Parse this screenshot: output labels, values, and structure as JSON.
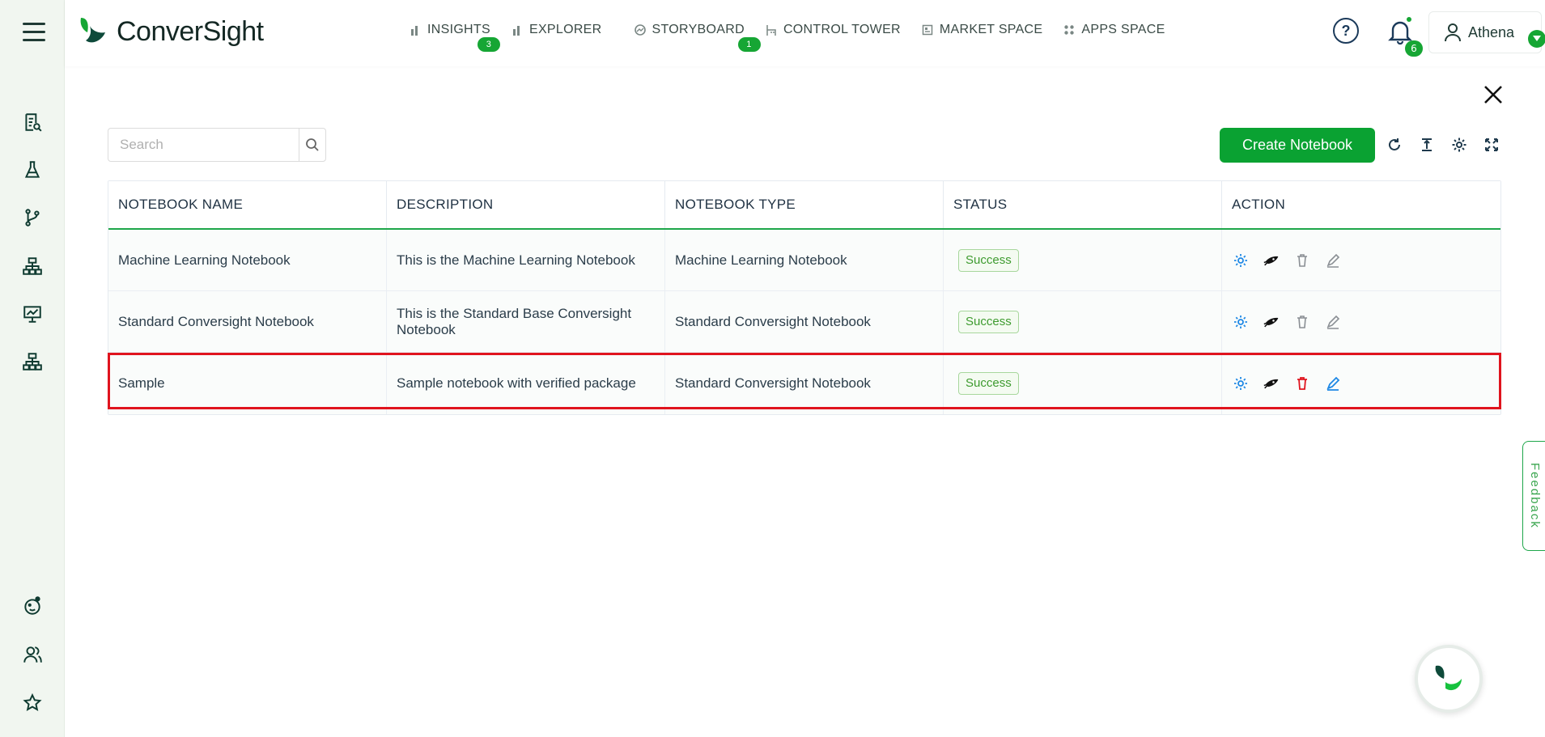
{
  "app": {
    "logo_text": "ConverSight"
  },
  "nav": {
    "items": [
      {
        "label": "INSIGHTS",
        "badge": "3"
      },
      {
        "label": "EXPLORER",
        "badge": ""
      },
      {
        "label": "STORYBOARD",
        "badge": "1"
      },
      {
        "label": "CONTROL TOWER",
        "badge": ""
      },
      {
        "label": "MARKET SPACE",
        "badge": ""
      },
      {
        "label": "APPS SPACE",
        "badge": ""
      }
    ]
  },
  "header": {
    "help_label": "?",
    "notification_count": "6",
    "user_name": "Athena"
  },
  "toolbar": {
    "search_placeholder": "Search",
    "search_value": "",
    "create_label": "Create Notebook"
  },
  "table": {
    "columns": [
      "NOTEBOOK NAME",
      "DESCRIPTION",
      "NOTEBOOK TYPE",
      "STATUS",
      "ACTION"
    ],
    "rows": [
      {
        "name": "Machine Learning Notebook",
        "description": "This is the Machine Learning Notebook",
        "type": "Machine Learning Notebook",
        "status": "Success"
      },
      {
        "name": "Standard Conversight Notebook",
        "description": "This is the Standard Base Conversight Notebook",
        "type": "Standard Conversight Notebook",
        "status": "Success"
      },
      {
        "name": "Sample",
        "description": "Sample notebook with verified package",
        "type": "Standard Conversight Notebook",
        "status": "Success"
      }
    ]
  },
  "feedback_label": "Feedback",
  "colors": {
    "brand_green": "#0aa232",
    "highlight_red": "#e0141e",
    "rail_bg": "#f1f6f0",
    "action_blue": "#1e88e5"
  },
  "icons": {
    "rail_top": [
      "report-icon",
      "flask-icon",
      "branch-icon",
      "hierarchy-icon",
      "presentation-icon",
      "hierarchy-icon"
    ],
    "rail_bottom": [
      "bot-face-icon",
      "users-icon",
      "star-icon"
    ]
  }
}
